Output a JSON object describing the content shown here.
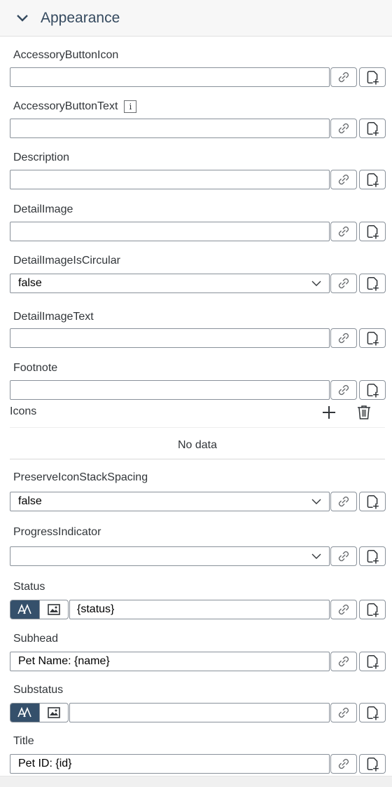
{
  "section": {
    "title": "Appearance",
    "icon": "chevron-down-icon"
  },
  "properties": {
    "accessory_button_icon": {
      "label": "AccessoryButtonIcon",
      "value": ""
    },
    "accessory_button_text": {
      "label": "AccessoryButtonText",
      "info": "i",
      "value": ""
    },
    "description": {
      "label": "Description",
      "value": ""
    },
    "detail_image": {
      "label": "DetailImage",
      "value": ""
    },
    "detail_image_is_circular": {
      "label": "DetailImageIsCircular",
      "value": "false"
    },
    "detail_image_text": {
      "label": "DetailImageText",
      "value": ""
    },
    "footnote": {
      "label": "Footnote",
      "value": ""
    },
    "icons": {
      "label": "Icons",
      "empty_text": "No data"
    },
    "preserve_icon_stack_spacing": {
      "label": "PreserveIconStackSpacing",
      "value": "false"
    },
    "progress_indicator": {
      "label": "ProgressIndicator",
      "value": ""
    },
    "status": {
      "label": "Status",
      "value": "{status}"
    },
    "subhead": {
      "label": "Subhead",
      "value": "Pet Name: {name}"
    },
    "substatus": {
      "label": "Substatus",
      "value": ""
    },
    "title": {
      "label": "Title",
      "value": "Pet ID: {id}"
    }
  },
  "icons": {
    "link": "link-icon",
    "add": "add-document-icon",
    "dropdown": "chevron-down-icon",
    "text_mode": "text-mode-icon",
    "image_mode": "image-mode-icon",
    "plus": "plus-icon",
    "trash": "trash-icon"
  },
  "colors": {
    "header_title": "#354a5f",
    "toggle_active": "#35506b",
    "border": "#89919a"
  }
}
